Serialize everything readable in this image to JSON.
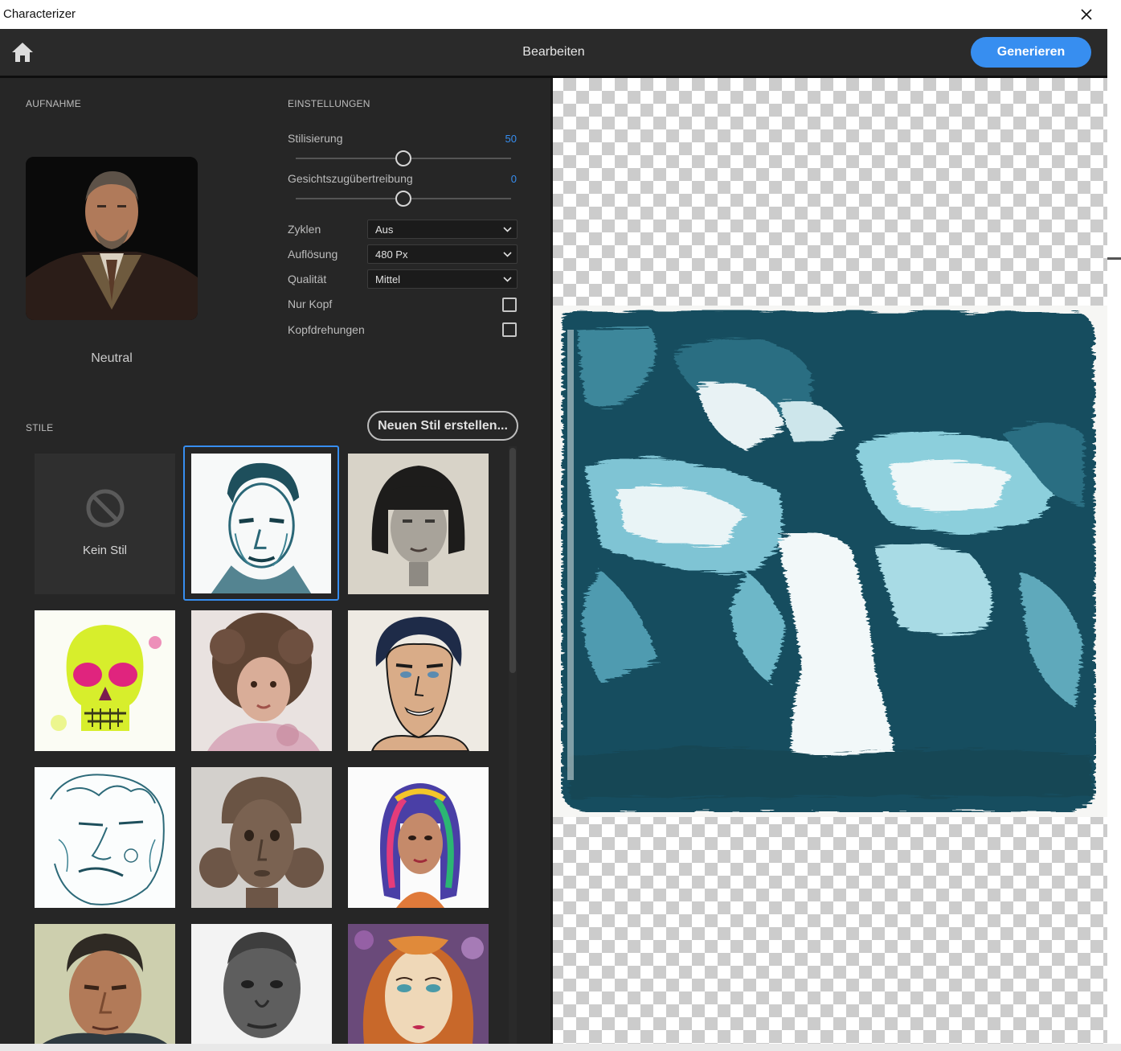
{
  "window": {
    "title": "Characterizer"
  },
  "header": {
    "title": "Bearbeiten",
    "generate_label": "Generieren"
  },
  "capture": {
    "section_label": "AUFNAHME",
    "photo_label": "Neutral"
  },
  "settings": {
    "section_label": "EINSTELLUNGEN",
    "sliders": [
      {
        "label": "Stilisierung",
        "value": "50",
        "fraction": 0.5
      },
      {
        "label": "Gesichtszugübertreibung",
        "value": "0",
        "fraction": 0.5
      }
    ],
    "dropdowns": [
      {
        "label": "Zyklen",
        "value": "Aus"
      },
      {
        "label": "Auflösung",
        "value": "480 Px"
      },
      {
        "label": "Qualität",
        "value": "Mittel"
      }
    ],
    "checkboxes": [
      {
        "label": "Nur Kopf",
        "checked": false
      },
      {
        "label": "Kopfdrehungen",
        "checked": false
      }
    ]
  },
  "styles": {
    "section_label": "STILE",
    "new_style_label": "Neuen Stil erstellen...",
    "no_style_label": "Kein Stil",
    "selected_index": 1
  },
  "colors": {
    "accent": "#378ef0",
    "panel": "#262626",
    "header": "#2a2a2a"
  }
}
